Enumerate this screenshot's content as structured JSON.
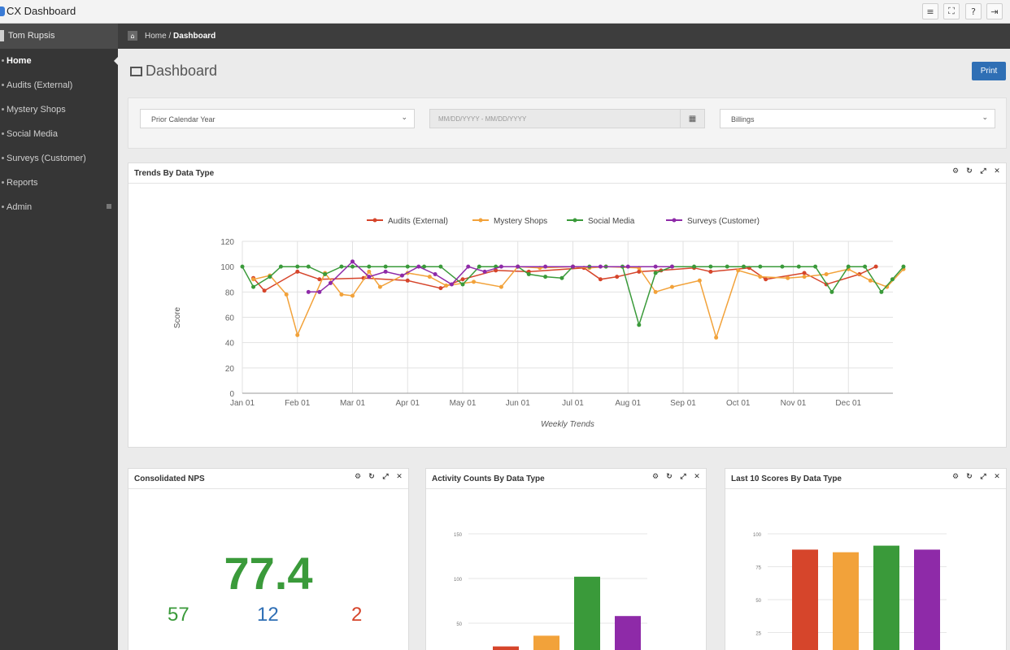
{
  "window": {
    "title": "CX Dashboard",
    "buttons": [
      "≡",
      "⛶",
      "?",
      "⇥"
    ]
  },
  "sidebar": {
    "user": "Tom Rupsis",
    "items": [
      {
        "label": "Home",
        "active": true
      },
      {
        "label": "Audits (External)"
      },
      {
        "label": "Mystery Shops"
      },
      {
        "label": "Social Media"
      },
      {
        "label": "Surveys (Customer)"
      },
      {
        "label": "Reports"
      },
      {
        "label": "Admin",
        "submenu": true
      }
    ]
  },
  "breadcrumb": {
    "home": "Home",
    "sep": " / ",
    "current": "Dashboard"
  },
  "page": {
    "title": "Dashboard",
    "print_label": "Print"
  },
  "filters": {
    "period": "Prior Calendar Year",
    "date_placeholder": "MM/DD/YYYY - MM/DD/YYYY",
    "location": "Billings"
  },
  "colors": {
    "audits": "#d6452b",
    "mystery": "#f2a23a",
    "social": "#3a9a3a",
    "surveys": "#8e2aa8"
  },
  "panels": {
    "trends": {
      "title": "Trends By Data Type"
    },
    "nps": {
      "title": "Consolidated NPS",
      "score": "77.4",
      "promoters": "57",
      "passives": "12",
      "detractors": "2"
    },
    "activity": {
      "title": "Activity Counts By Data Type"
    },
    "last10": {
      "title": "Last 10 Scores By Data Type"
    }
  },
  "chart_data": [
    {
      "type": "line",
      "title": "",
      "xlabel": "Weekly Trends",
      "ylabel": "Score",
      "ylim": [
        0,
        120
      ],
      "yticks": [
        0,
        20,
        40,
        60,
        80,
        100,
        120
      ],
      "xticks": [
        "Jan 01",
        "Feb 01",
        "Mar 01",
        "Apr 01",
        "May 01",
        "Jun 01",
        "Jul 01",
        "Aug 01",
        "Sep 01",
        "Oct 01",
        "Nov 01",
        "Dec 01"
      ],
      "legend_position": "top",
      "grid": true,
      "series": [
        {
          "name": "Audits (External)",
          "color": "#d6452b",
          "points": [
            [
              0.2,
              91
            ],
            [
              0.4,
              81
            ],
            [
              1.0,
              96
            ],
            [
              1.4,
              90
            ],
            [
              2.2,
              91
            ],
            [
              3.0,
              89
            ],
            [
              3.6,
              83
            ],
            [
              4.0,
              90
            ],
            [
              4.6,
              97
            ],
            [
              5.2,
              96
            ],
            [
              6.2,
              99
            ],
            [
              6.5,
              90
            ],
            [
              6.8,
              92
            ],
            [
              7.2,
              96
            ],
            [
              7.6,
              97
            ],
            [
              8.2,
              99
            ],
            [
              8.5,
              96
            ],
            [
              9.2,
              99
            ],
            [
              9.5,
              90
            ],
            [
              10.2,
              95
            ],
            [
              10.6,
              86
            ],
            [
              11.2,
              94
            ],
            [
              11.5,
              100
            ]
          ]
        },
        {
          "name": "Mystery Shops",
          "color": "#f2a23a",
          "points": [
            [
              0.2,
              90
            ],
            [
              0.5,
              93
            ],
            [
              0.8,
              78
            ],
            [
              1.0,
              46
            ],
            [
              1.5,
              95
            ],
            [
              1.8,
              78
            ],
            [
              2.0,
              77
            ],
            [
              2.3,
              96
            ],
            [
              2.5,
              84
            ],
            [
              3.0,
              95
            ],
            [
              3.4,
              92
            ],
            [
              3.7,
              85
            ],
            [
              4.2,
              88
            ],
            [
              4.7,
              84
            ],
            [
              5.0,
              100
            ],
            [
              5.4,
              99
            ],
            [
              6.0,
              100
            ],
            [
              6.3,
              99
            ],
            [
              6.6,
              100
            ],
            [
              7.2,
              99
            ],
            [
              7.5,
              80
            ],
            [
              7.8,
              84
            ],
            [
              8.3,
              89
            ],
            [
              8.6,
              44
            ],
            [
              9.0,
              97
            ],
            [
              9.4,
              92
            ],
            [
              9.9,
              91
            ],
            [
              10.2,
              92
            ],
            [
              10.6,
              94
            ],
            [
              11.0,
              98
            ],
            [
              11.4,
              89
            ],
            [
              11.7,
              84
            ],
            [
              12.0,
              98
            ]
          ]
        },
        {
          "name": "Social Media",
          "color": "#3a9a3a",
          "points": [
            [
              0.0,
              100
            ],
            [
              0.2,
              84
            ],
            [
              0.5,
              92
            ],
            [
              0.7,
              100
            ],
            [
              1.0,
              100
            ],
            [
              1.2,
              100
            ],
            [
              1.5,
              94
            ],
            [
              1.8,
              100
            ],
            [
              2.0,
              100
            ],
            [
              2.3,
              100
            ],
            [
              2.6,
              100
            ],
            [
              3.0,
              100
            ],
            [
              3.3,
              100
            ],
            [
              3.6,
              100
            ],
            [
              4.0,
              86
            ],
            [
              4.3,
              100
            ],
            [
              4.6,
              100
            ],
            [
              5.0,
              100
            ],
            [
              5.2,
              94
            ],
            [
              5.5,
              92
            ],
            [
              5.8,
              91
            ],
            [
              6.0,
              100
            ],
            [
              6.3,
              100
            ],
            [
              6.6,
              100
            ],
            [
              6.9,
              100
            ],
            [
              7.2,
              54
            ],
            [
              7.5,
              95
            ],
            [
              7.8,
              100
            ],
            [
              8.2,
              100
            ],
            [
              8.5,
              100
            ],
            [
              8.8,
              100
            ],
            [
              9.1,
              100
            ],
            [
              9.4,
              100
            ],
            [
              9.8,
              100
            ],
            [
              10.1,
              100
            ],
            [
              10.4,
              100
            ],
            [
              10.7,
              80
            ],
            [
              11.0,
              100
            ],
            [
              11.3,
              100
            ],
            [
              11.6,
              80
            ],
            [
              11.8,
              90
            ],
            [
              12.0,
              100
            ]
          ]
        },
        {
          "name": "Surveys (Customer)",
          "color": "#8e2aa8",
          "points": [
            [
              1.2,
              80
            ],
            [
              1.4,
              80
            ],
            [
              1.6,
              87
            ],
            [
              2.0,
              104
            ],
            [
              2.3,
              92
            ],
            [
              2.6,
              96
            ],
            [
              2.9,
              93
            ],
            [
              3.2,
              100
            ],
            [
              3.5,
              94
            ],
            [
              3.8,
              86
            ],
            [
              4.1,
              100
            ],
            [
              4.4,
              96
            ],
            [
              4.7,
              100
            ],
            [
              5.0,
              100
            ],
            [
              5.5,
              100
            ],
            [
              6.0,
              100
            ],
            [
              6.5,
              100
            ],
            [
              7.0,
              100
            ],
            [
              7.5,
              100
            ],
            [
              7.8,
              100
            ]
          ]
        }
      ]
    },
    {
      "type": "bar",
      "title": "",
      "categories": [
        "Audits (External)",
        "Mystery Shops",
        "Social Media",
        "Surveys (Customer)"
      ],
      "values": [
        24,
        36,
        102,
        58
      ],
      "yticks": [
        50,
        100,
        150
      ],
      "ylim": [
        0,
        150
      ],
      "colors": [
        "#d6452b",
        "#f2a23a",
        "#3a9a3a",
        "#8e2aa8"
      ]
    },
    {
      "type": "bar",
      "title": "",
      "categories": [
        "Audits (External)",
        "Mystery Shops",
        "Social Media",
        "Surveys (Customer)"
      ],
      "values": [
        88,
        86,
        91,
        88
      ],
      "yticks": [
        25,
        50,
        75,
        100
      ],
      "ylim": [
        0,
        100
      ],
      "colors": [
        "#d6452b",
        "#f2a23a",
        "#3a9a3a",
        "#8e2aa8"
      ]
    }
  ]
}
